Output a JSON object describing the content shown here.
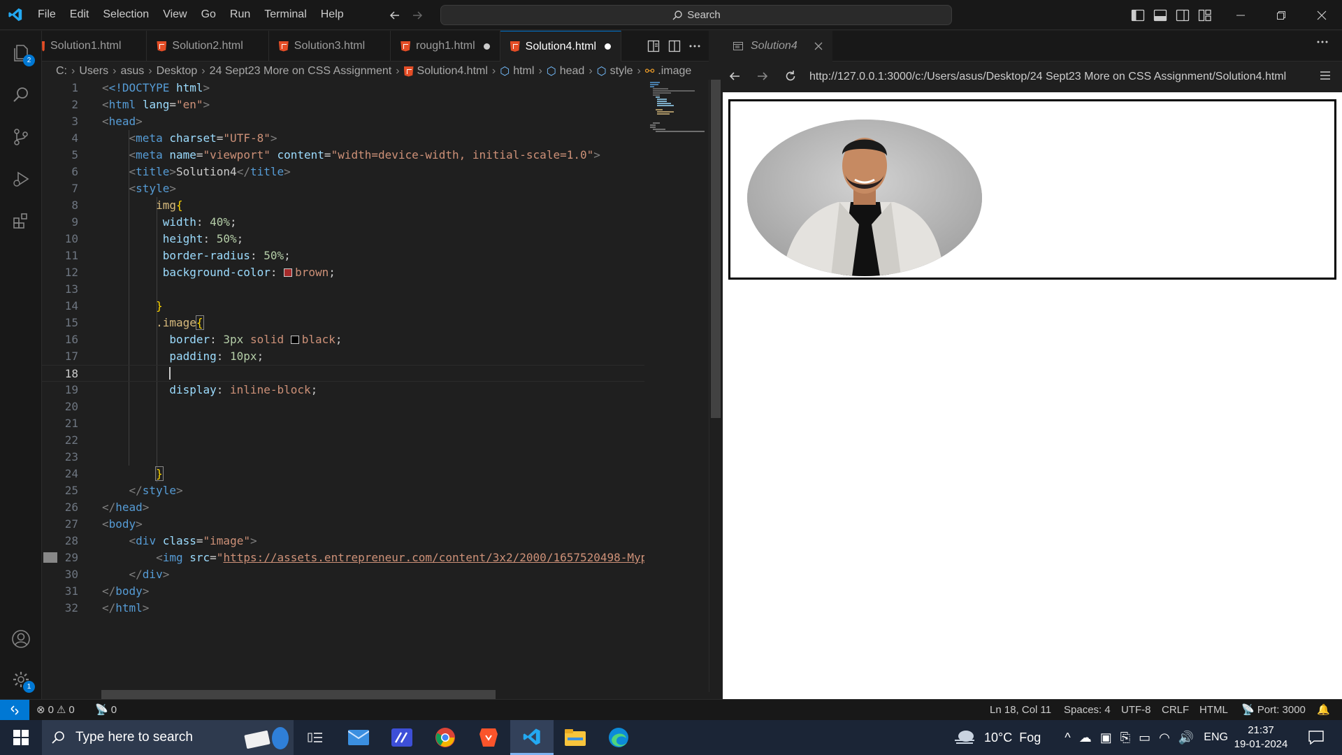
{
  "titlebar": {
    "menu": [
      "File",
      "Edit",
      "Selection",
      "View",
      "Go",
      "Run",
      "Terminal",
      "Help"
    ],
    "search_label": "Search"
  },
  "activity": {
    "explorer_badge": "2",
    "settings_badge": "1"
  },
  "tabs": [
    {
      "label": "Solution1.html",
      "modified": false,
      "active": false
    },
    {
      "label": "Solution2.html",
      "modified": false,
      "active": false
    },
    {
      "label": "Solution3.html",
      "modified": false,
      "active": false
    },
    {
      "label": "rough1.html",
      "modified": true,
      "active": false
    },
    {
      "label": "Solution4.html",
      "modified": true,
      "active": true
    }
  ],
  "breadcrumb": [
    "C:",
    "Users",
    "asus",
    "Desktop",
    "24 Sept23 More on CSS Assignment",
    "Solution4.html",
    "html",
    "head",
    "style",
    ".image"
  ],
  "editor": {
    "lines": [
      "1",
      "2",
      "3",
      "4",
      "5",
      "6",
      "7",
      "8",
      "9",
      "10",
      "11",
      "12",
      "13",
      "14",
      "15",
      "16",
      "17",
      "18",
      "19",
      "20",
      "21",
      "22",
      "23",
      "24",
      "25",
      "26",
      "27",
      "28",
      "29",
      "30",
      "31",
      "32"
    ],
    "current_line": 18,
    "code": {
      "l1": {
        "a": "<!DOCTYPE",
        "b": " html",
        "c": ">"
      },
      "l2": {
        "tag": "html",
        "attr": "lang",
        "val": "\"en\""
      },
      "l3": {
        "tag": "head"
      },
      "l4": {
        "tag": "meta",
        "attr": "charset",
        "val": "\"UTF-8\""
      },
      "l5": {
        "tag": "meta",
        "attr1": "name",
        "val1": "\"viewport\"",
        "attr2": "content",
        "val2": "\"width=device-width, initial-scale=1.0\""
      },
      "l6": {
        "tag": "title",
        "text": "Solution4"
      },
      "l7": {
        "tag": "style"
      },
      "l8": {
        "sel": "img"
      },
      "l9": {
        "prop": "width",
        "val": "40%"
      },
      "l10": {
        "prop": "height",
        "val": "50%"
      },
      "l11": {
        "prop": "border-radius",
        "val": "50%"
      },
      "l12": {
        "prop": "background-color",
        "val": "brown"
      },
      "l15": {
        "sel": ".image"
      },
      "l16": {
        "prop": "border",
        "v1": "3px",
        "v2": "solid",
        "v3": "black"
      },
      "l17": {
        "prop": "padding",
        "val": "10px"
      },
      "l19": {
        "prop": "display",
        "val": "inline-block"
      },
      "l25": {
        "tag": "style"
      },
      "l26": {
        "tag": "head"
      },
      "l27": {
        "tag": "body"
      },
      "l28": {
        "tag": "div",
        "attr": "class",
        "val": "\"image\""
      },
      "l29": {
        "tag": "img",
        "attr": "src",
        "val": "https://assets.entrepreneur.com/content/3x2/2000/1657520498-Myp"
      },
      "l30": {
        "tag": "div"
      },
      "l31": {
        "tag": "body"
      },
      "l32": {
        "tag": "html"
      }
    },
    "brown_swatch": "#a52a2a",
    "black_swatch": "#000000"
  },
  "browser": {
    "tab_title": "Solution4",
    "url": "http://127.0.0.1:3000/c:/Users/asus/Desktop/24 Sept23 More on CSS Assignment/Solution4.html"
  },
  "status": {
    "errors": "0",
    "warnings": "0",
    "ports": "0",
    "position": "Ln 18, Col 11",
    "spaces": "Spaces: 4",
    "encoding": "UTF-8",
    "eol": "CRLF",
    "language": "HTML",
    "port": "Port: 3000"
  },
  "taskbar": {
    "search_placeholder": "Type here to search",
    "weather": "10°C",
    "weather_desc": "Fog",
    "lang": "ENG",
    "time": "21:37",
    "date": "19-01-2024"
  }
}
